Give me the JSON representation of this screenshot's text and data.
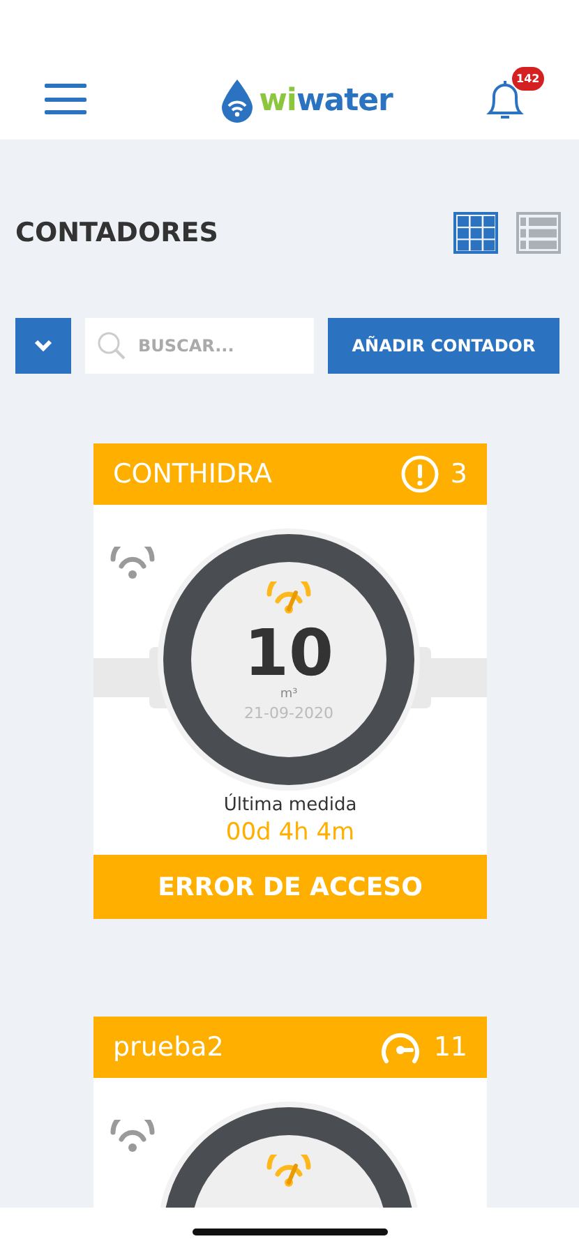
{
  "header": {
    "logo": {
      "part_1": "wi",
      "part_2": "water"
    },
    "notifications": {
      "count": "142"
    }
  },
  "title": "CONTADORES",
  "views": [
    {
      "kind": "grid",
      "selected": true
    },
    {
      "kind": "list",
      "selected": false
    }
  ],
  "search": {
    "placeholder": "BUSCAR..."
  },
  "add_button": "AÑADIR CONTADOR",
  "meters": [
    {
      "name": "CONTHIDRA",
      "badge": {
        "kind": "alert",
        "count": "3"
      },
      "reading": "10",
      "unit": "m³",
      "date": "21-09-2020",
      "last_label": "Última medida",
      "last_value": "00d 4h 4m",
      "status": "ERROR DE ACCESO"
    },
    {
      "name": "prueba2",
      "badge": {
        "kind": "gauge",
        "count": "11"
      }
    }
  ]
}
